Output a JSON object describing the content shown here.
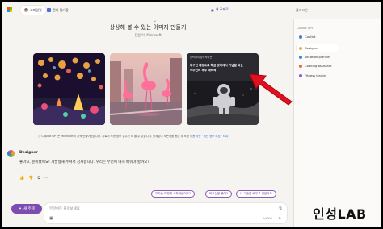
{
  "tabs": [
    {
      "label": "코파일럿",
      "active": true
    },
    {
      "label": "전자 필기장",
      "active": false
    }
  ],
  "top_new": "새 주제로",
  "sidebar": {
    "header": "플러그인",
    "section": "Copilot GPT",
    "items": [
      {
        "label": "Copilot",
        "color": "#3f7fd6",
        "active": false
      },
      {
        "label": "Designer",
        "color": "#e0b23a",
        "active": true
      },
      {
        "label": "Vacation planner",
        "color": "#2e8fd6",
        "active": false
      },
      {
        "label": "Cooking assistant",
        "color": "#e36b3c",
        "active": false
      },
      {
        "label": "Fitness trainer",
        "color": "#8a5ac6",
        "active": false
      }
    ]
  },
  "hero": {
    "title": "상상해 볼 수 있는 이미지 만들기",
    "subtitle": "전원 이, Microsoft"
  },
  "cards": [
    {
      "alt": "lantern night scene"
    },
    {
      "alt": "flamingos in city street"
    },
    {
      "alt": "astronaut on moon",
      "caption_line1": "전력하여 당으작되는",
      "caption_line2": "지구인 배경으로 해금 맞이에서 기념할 되는",
      "caption_line3": "우주인의 우주 매력적"
    }
  ],
  "note": {
    "text": "ⓘ Copilot GPT는 Microsoft의 지적 만들어졌습니다. 자료이 또한 정보 실수가 도 들 수 있습니다. 전체분이 모든내를 용금 부 조정",
    "link": "이용 약관 · 개인 정보 보호 · FAQ"
  },
  "bot": {
    "name": "Designer",
    "message": "좋아요, 준비됐어요! 계발형해 주셔서 감사합니다. 우리는 무언에 대해 배워야 할까요?"
  },
  "suggestions": [
    "우리는 어떻게 시작하겠어요?",
    "비오실을 봤어?",
    "내 기술을 배우고 싶었어요"
  ],
  "composer": {
    "new_topic": "새 주제",
    "placeholder": "무엇이든 물어보세요",
    "count": "0/4000"
  },
  "watermark": "인성LAB"
}
